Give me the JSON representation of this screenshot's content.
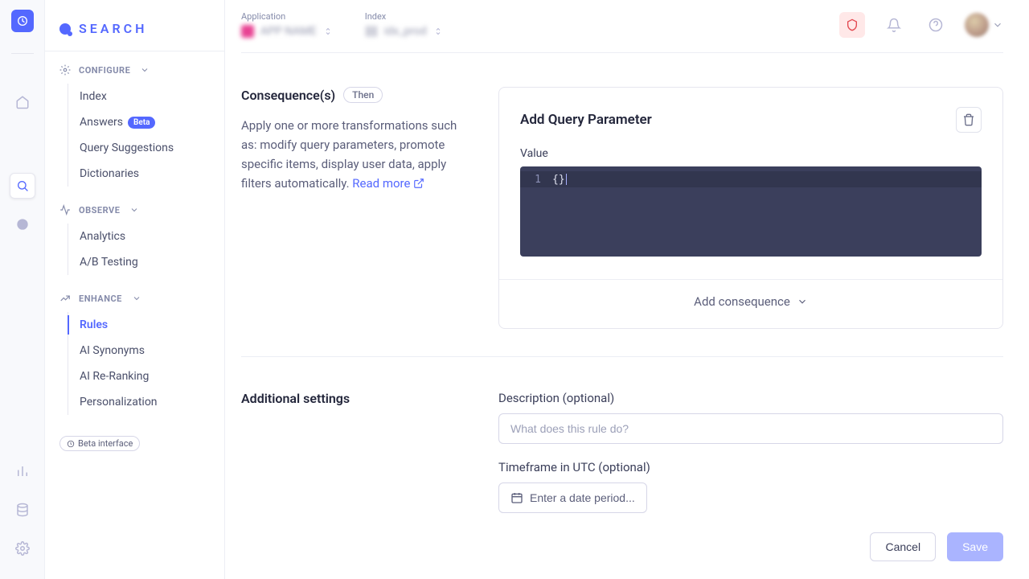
{
  "brand": {
    "name": "SEARCH"
  },
  "rail": {
    "items_mid": [
      "home-icon",
      "search-icon",
      "tip-icon"
    ],
    "items_bottom": [
      "chart-icon",
      "database-icon",
      "gear-icon"
    ]
  },
  "sidebar": {
    "groups": [
      {
        "label": "CONFIGURE",
        "items": [
          {
            "label": "Index"
          },
          {
            "label": "Answers",
            "badge": "Beta"
          },
          {
            "label": "Query Suggestions"
          },
          {
            "label": "Dictionaries"
          }
        ]
      },
      {
        "label": "OBSERVE",
        "items": [
          {
            "label": "Analytics"
          },
          {
            "label": "A/B Testing"
          }
        ]
      },
      {
        "label": "ENHANCE",
        "items": [
          {
            "label": "Rules",
            "active": true
          },
          {
            "label": "AI Synonyms"
          },
          {
            "label": "AI Re-Ranking"
          },
          {
            "label": "Personalization"
          }
        ]
      }
    ],
    "beta_chip": "Beta interface"
  },
  "topbar": {
    "app_label": "Application",
    "app_value": "APP NAME",
    "index_label": "Index",
    "index_value": "idx_prod"
  },
  "consequence": {
    "title": "Consequence(s)",
    "pill": "Then",
    "desc": "Apply one or more transformations such as: modify query parameters, promote specific items, display user data, apply filters automatically. ",
    "readmore": "Read more",
    "card_title": "Add Query Parameter",
    "value_label": "Value",
    "code_line_no": "1",
    "code_value": "{}",
    "add_consequence": "Add consequence"
  },
  "additional": {
    "title": "Additional settings",
    "desc_label": "Description (optional)",
    "desc_placeholder": "What does this rule do?",
    "timeframe_label": "Timeframe in UTC (optional)",
    "timeframe_placeholder": "Enter a date period..."
  },
  "actions": {
    "cancel": "Cancel",
    "save": "Save"
  }
}
